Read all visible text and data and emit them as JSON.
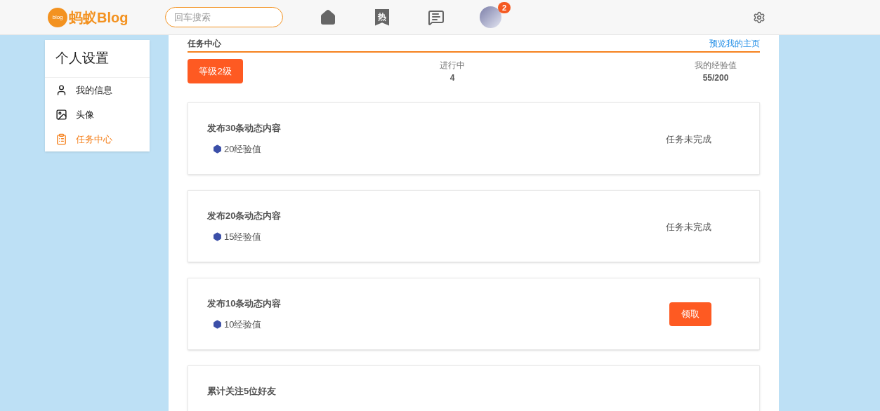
{
  "header": {
    "logo": "蚂蚁Blog",
    "logo_badge": "blog",
    "search": {
      "placeholder": "回车搜索"
    },
    "nav": [
      {
        "kind": "home"
      },
      {
        "kind": "hot",
        "label": "热"
      },
      {
        "kind": "message"
      }
    ],
    "avatar_badge": "2"
  },
  "sidebar": {
    "title": "个人设置",
    "items": [
      {
        "kind": "user",
        "label": "我的信息",
        "selected": false
      },
      {
        "kind": "image",
        "label": "头像",
        "selected": false
      },
      {
        "kind": "clipboard",
        "label": "任务中心",
        "selected": true
      }
    ]
  },
  "main": {
    "title": "任务中心",
    "link": "预览我的主页",
    "level_button": "等级2级",
    "stats": [
      {
        "label": "进行中",
        "value": "4"
      },
      {
        "label": "我的经验值",
        "value": "55/200"
      }
    ],
    "tasks": [
      {
        "title": "发布30条动态内容",
        "reward": "20经验值",
        "kind": "status",
        "status": "任务未完成"
      },
      {
        "title": "发布20条动态内容",
        "reward": "15经验值",
        "kind": "status",
        "status": "任务未完成"
      },
      {
        "title": "发布10条动态内容",
        "reward": "10经验值",
        "kind": "claim",
        "status": "领取"
      },
      {
        "title": "累计关注5位好友"
      }
    ]
  }
}
